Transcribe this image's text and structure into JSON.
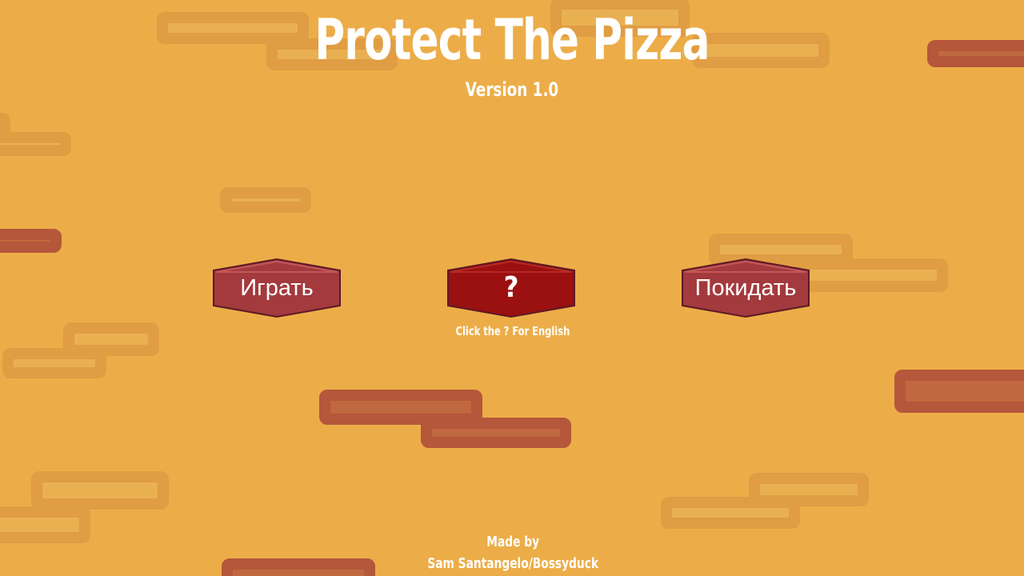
{
  "game": {
    "title": "Protect The Pizza",
    "version": "Version 1.0"
  },
  "menu": {
    "play_label": "Играть",
    "help_label": "?",
    "quit_label": "Покидать",
    "hint": "Click the ? For English"
  },
  "credits": {
    "line1": "Made by",
    "line2": "Sam Santangelo/Bossyduck"
  },
  "colors": {
    "background": "#ecad48",
    "brick_light": "#e09d43",
    "brick_light_inner": "#e9b052",
    "brick_dark": "#b5573a",
    "brick_dark_inner": "#c0683f",
    "button_fill": "#a33a3e",
    "button_fill_active": "#9b1010",
    "button_border": "#5c1a24",
    "text": "#ffffff"
  }
}
